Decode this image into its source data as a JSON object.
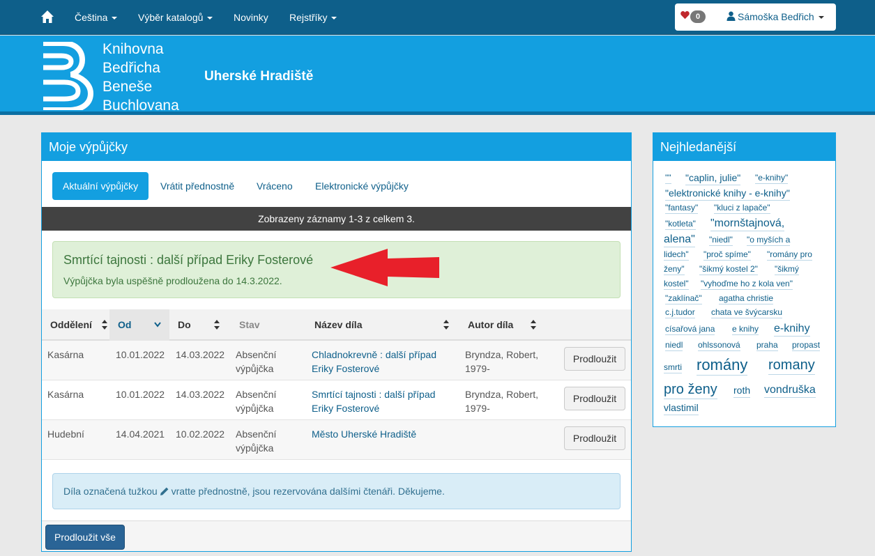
{
  "nav": {
    "language": "Čeština",
    "catalogs": "Výběr katalogů",
    "news": "Novinky",
    "indexes": "Rejstříky",
    "favorites_count": "0",
    "user": "Sámoška Bedřich"
  },
  "header": {
    "logo_lines": [
      "Knihovna",
      "Bedřicha",
      "Beneše",
      "Buchlovana"
    ],
    "city": "Uherské Hradiště"
  },
  "loans": {
    "title": "Moje výpůjčky",
    "tabs": [
      "Aktuální výpůjčky",
      "Vrátit přednostně",
      "Vráceno",
      "Elektronické výpůjčky"
    ],
    "records_info": "Zobrazeny záznamy 1-3 z celkem 3.",
    "alert": {
      "title": "Smrtící tajnosti : další případ Eriky Fosterové",
      "text": "Výpůjčka byla uspěšně prodloužena do 14.3.2022."
    },
    "columns": [
      "Oddělení",
      "Od",
      "Do",
      "Stav",
      "Název díla",
      "Autor díla"
    ],
    "rows": [
      {
        "dept": "Kasárna",
        "from": "10.01.2022",
        "to": "14.03.2022",
        "status1": "Absenční",
        "status2": "výpůjčka",
        "title1": "Chladnokrevně : další případ",
        "title2": "Eriky Fosterové",
        "author1": "Bryndza, Robert,",
        "author2": "1979-",
        "button": "Prodloužit"
      },
      {
        "dept": "Kasárna",
        "from": "10.01.2022",
        "to": "14.03.2022",
        "status1": "Absenční",
        "status2": "výpůjčka",
        "title1": "Smrtící tajnosti : další případ",
        "title2": "Eriky Fosterové",
        "author1": "Bryndza, Robert,",
        "author2": "1979-",
        "button": "Prodloužit"
      },
      {
        "dept": "Hudební",
        "from": "14.04.2021",
        "to": "10.02.2022",
        "status1": "Absenční",
        "status2": "výpůjčka",
        "title1": "Město Uherské Hradiště",
        "title2": "",
        "author1": "",
        "author2": "",
        "button": "Prodloužit"
      }
    ],
    "info_before": "Díla označená tužkou",
    "info_after": "vratte přednostně, jsou rezervována dalšími čtenáři. Děkujeme.",
    "renew_all": "Prodloužit vše"
  },
  "popular": {
    "title": "Nejhledanější",
    "tags": [
      "\"\"",
      "\"caplin, julie\"",
      "\"e-knihy\"",
      "\"elektronické knihy - e-knihy\"",
      "\"fantasy\"",
      "\"kluci z lapače\"",
      "\"kotleta\"",
      "\"mornštajnová,",
      "alena\"",
      "\"niedl\"",
      "\"o myších a",
      "lidech\"",
      "\"proč spíme\"",
      "\"romány pro",
      "ženy\"",
      "\"šikmý kostel 2\"",
      "\"šikmý",
      "kostel\"",
      "\"vyhoďme ho z kola ven\"",
      "\"zaklínač\"",
      "agatha christie",
      "c.j.tudor",
      "chata ve švýcarsku",
      "císařová jana",
      "e knihy",
      "e-knihy",
      "niedl",
      "ohlssonová",
      "praha",
      "propast",
      "smrti",
      "romány",
      "romany",
      "pro ženy",
      "roth",
      "vondruška",
      "vlastimil"
    ]
  },
  "colors": {
    "nav_bg": "#0e5f8a",
    "header_bg": "#139fe0",
    "alert_bg": "#dff0d8",
    "arrow": "#e8202a"
  },
  "icons": [
    "home-icon",
    "heart-icon",
    "user-icon",
    "sort-icon",
    "pencil-icon",
    "library-logo"
  ]
}
